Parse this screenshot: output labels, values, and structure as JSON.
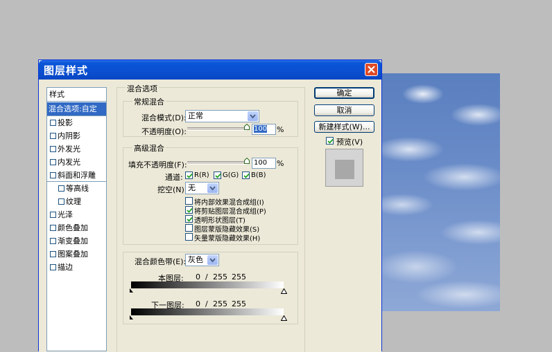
{
  "dialog": {
    "title": "图层样式",
    "style_list": {
      "header": "样式",
      "selected": "混合选项:自定",
      "items": [
        {
          "label": "投影",
          "checked": false,
          "indent": false
        },
        {
          "label": "内阴影",
          "checked": false,
          "indent": false
        },
        {
          "label": "外发光",
          "checked": false,
          "indent": false
        },
        {
          "label": "内发光",
          "checked": false,
          "indent": false
        },
        {
          "label": "斜面和浮雕",
          "checked": false,
          "indent": false
        },
        {
          "label": "等高线",
          "checked": false,
          "indent": true
        },
        {
          "label": "纹理",
          "checked": false,
          "indent": true
        },
        {
          "label": "光泽",
          "checked": false,
          "indent": false
        },
        {
          "label": "颜色叠加",
          "checked": false,
          "indent": false
        },
        {
          "label": "渐变叠加",
          "checked": false,
          "indent": false
        },
        {
          "label": "图案叠加",
          "checked": false,
          "indent": false
        },
        {
          "label": "描边",
          "checked": false,
          "indent": false
        }
      ]
    },
    "blend_options": {
      "legend": "混合选项",
      "general": {
        "legend": "常规混合",
        "mode_label": "混合模式(D):",
        "mode_value": "正常",
        "opacity_label": "不透明度(O):",
        "opacity_value": "100",
        "percent": "%"
      },
      "advanced": {
        "legend": "高级混合",
        "fill_label": "填充不透明度(F):",
        "fill_value": "100",
        "percent": "%",
        "channels_label": "通道:",
        "channels": [
          {
            "label": "R(R)",
            "checked": true
          },
          {
            "label": "G(G)",
            "checked": true
          },
          {
            "label": "B(B)",
            "checked": true
          }
        ],
        "knockout_label": "挖空(N):",
        "knockout_value": "无",
        "options": [
          {
            "label": "将内部效果混合成组(I)",
            "checked": false
          },
          {
            "label": "将剪贴图层混合成组(P)",
            "checked": true
          },
          {
            "label": "透明形状图层(T)",
            "checked": true
          },
          {
            "label": "图层蒙版隐藏效果(S)",
            "checked": false
          },
          {
            "label": "矢量蒙版隐藏效果(H)",
            "checked": false
          }
        ]
      },
      "blend_if": {
        "label": "混合颜色带(E):",
        "value": "灰色",
        "this_layer": {
          "label": "本图层:",
          "black": "0",
          "slash": "/",
          "mid": "255",
          "white": "255"
        },
        "underlying": {
          "label": "下一图层:",
          "black": "0",
          "slash": "/",
          "mid": "255",
          "white": "255"
        }
      }
    },
    "buttons": {
      "ok": "确定",
      "cancel": "取消",
      "new_style": "新建样式(W)...",
      "preview": "预览(V)",
      "preview_checked": true
    }
  }
}
